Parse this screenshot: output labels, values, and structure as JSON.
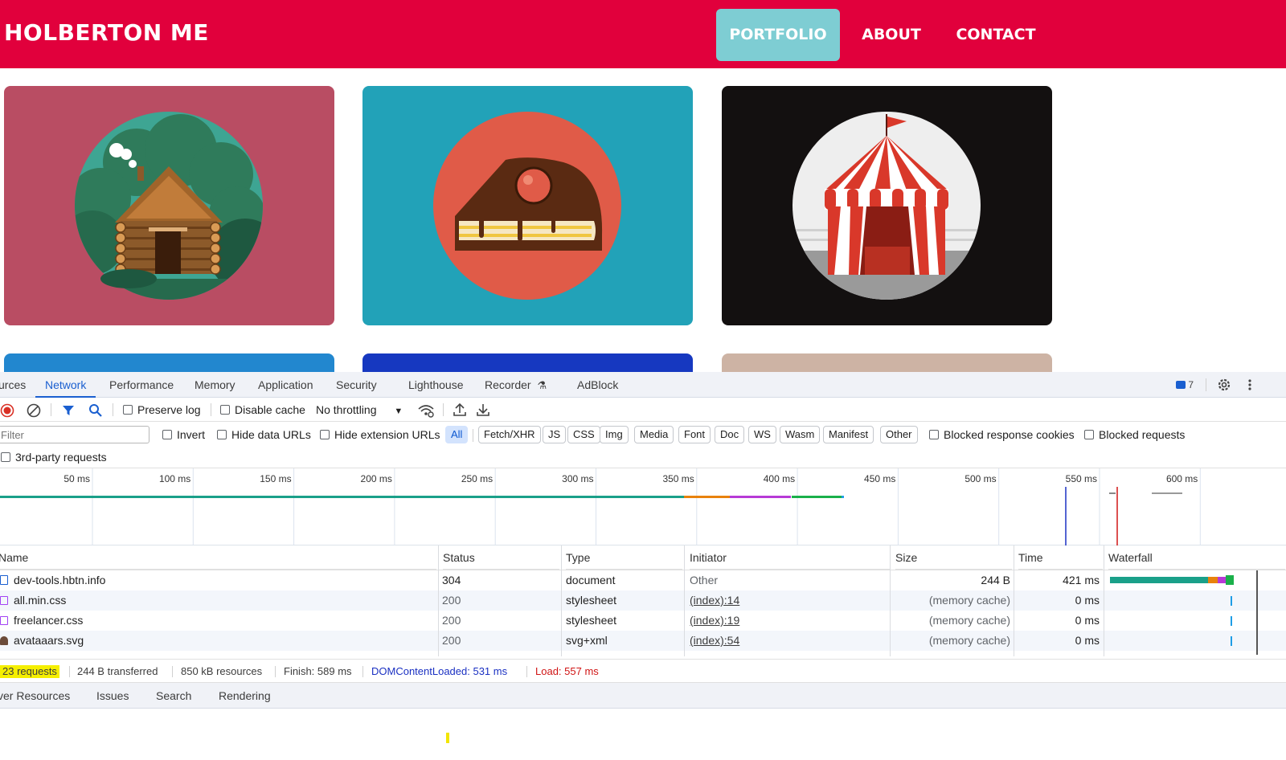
{
  "site": {
    "title": "HOLBERTON ME",
    "nav": {
      "portfolio": "PORTFOLIO",
      "about": "ABOUT",
      "contact": "CONTACT"
    },
    "colors": {
      "header": "#e1003c",
      "active_nav": "#7ecdd3"
    },
    "cards": [
      {
        "name": "log-cabin",
        "bg": "#b94d63"
      },
      {
        "name": "cake-slice",
        "bg": "#22a2b8"
      },
      {
        "name": "circus-tent",
        "bg": "#131010"
      },
      {
        "name": "card-4",
        "bg": "#2287cf"
      },
      {
        "name": "card-5",
        "bg": "#1638c0"
      },
      {
        "name": "card-6",
        "bg": "#cdb3a4"
      }
    ]
  },
  "devtools": {
    "tabs": [
      "urces",
      "Network",
      "Performance",
      "Memory",
      "Application",
      "Security",
      "Lighthouse",
      "Recorder",
      "AdBlock"
    ],
    "active_tab": "Network",
    "issues_count": "7",
    "toolbar": {
      "preserve_log": "Preserve log",
      "disable_cache": "Disable cache",
      "throttling": "No throttling"
    },
    "filter": {
      "placeholder": "Filter",
      "invert": "Invert",
      "hide_data_urls": "Hide data URLs",
      "hide_extension_urls": "Hide extension URLs",
      "types": [
        "All",
        "Fetch/XHR",
        "JS",
        "CSS",
        "Img",
        "Media",
        "Font",
        "Doc",
        "WS",
        "Wasm",
        "Manifest",
        "Other"
      ],
      "blocked_response_cookies": "Blocked response cookies",
      "blocked_requests": "Blocked requests",
      "third_party": "3rd-party requests"
    },
    "timeline_ticks": [
      "50 ms",
      "100 ms",
      "150 ms",
      "200 ms",
      "250 ms",
      "300 ms",
      "350 ms",
      "400 ms",
      "450 ms",
      "500 ms",
      "550 ms",
      "600 ms"
    ],
    "columns": [
      "Name",
      "Status",
      "Type",
      "Initiator",
      "Size",
      "Time",
      "Waterfall"
    ],
    "rows": [
      {
        "name": "dev-tools.hbtn.info",
        "status": "304",
        "type": "document",
        "initiator": "Other",
        "size": "244 B",
        "time": "421 ms"
      },
      {
        "name": "all.min.css",
        "status": "200",
        "type": "stylesheet",
        "initiator": "(index):14",
        "size": "(memory cache)",
        "time": "0 ms"
      },
      {
        "name": "freelancer.css",
        "status": "200",
        "type": "stylesheet",
        "initiator": "(index):19",
        "size": "(memory cache)",
        "time": "0 ms"
      },
      {
        "name": "avataaars.svg",
        "status": "200",
        "type": "svg+xml",
        "initiator": "(index):54",
        "size": "(memory cache)",
        "time": "0 ms"
      }
    ],
    "summary": {
      "requests": "23 requests",
      "transferred": "244 B transferred",
      "resources": "850 kB resources",
      "finish": "Finish: 589 ms",
      "dom_content_loaded": "DOMContentLoaded: 531 ms",
      "load": "Load: 557 ms"
    },
    "drawer_tabs": [
      "ver Resources",
      "Issues",
      "Search",
      "Rendering"
    ]
  }
}
